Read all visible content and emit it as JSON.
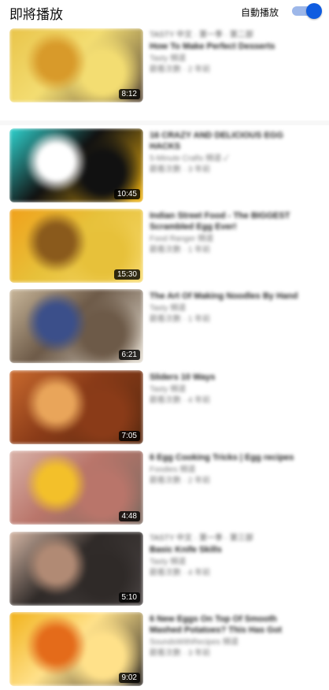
{
  "header": {
    "title": "即將播放",
    "autoplay_label": "自動播放",
    "autoplay_on": true,
    "accent": "#0f5ce0"
  },
  "videos": [
    {
      "tag": "TASTY 中文 · 第一季 · 第二部",
      "title": "How To Make Perfect Desserts",
      "channel": "Tasty 頻道",
      "stats": "觀看次數 · 2 年前",
      "duration": "8:12",
      "colors": [
        "#e9c44a",
        "#f3dd72",
        "#d89a2a",
        "#5a4a3a"
      ]
    },
    {
      "tag": "",
      "title": "16 CRAZY AND DELICIOUS EGG HACKS",
      "channel": "5-Minute Crafts 頻道 ✓",
      "stats": "觀看次數 · 3 年前",
      "duration": "10:45",
      "colors": [
        "#2fd3cf",
        "#111111",
        "#ffffff",
        "#f2b40f"
      ]
    },
    {
      "tag": "",
      "title": "Indian Street Food - The BIGGEST Scrambled Egg Ever!",
      "channel": "Food Ranger 頻道",
      "stats": "觀看次數 · 1 年前",
      "duration": "15:30",
      "colors": [
        "#f0a11b",
        "#e7c13a",
        "#8a5a1c",
        "#f6d86a"
      ]
    },
    {
      "tag": "",
      "title": "The Art Of Making Noodles By Hand",
      "channel": "Tasty 頻道",
      "stats": "觀看次數 · 1 年前",
      "duration": "6:21",
      "colors": [
        "#c9b79a",
        "#6d5a48",
        "#3b4f8a",
        "#e4ddd1"
      ]
    },
    {
      "tag": "",
      "title": "Sliders 10 Ways",
      "channel": "Tasty 頻道",
      "stats": "觀看次數 · 4 年前",
      "duration": "7:05",
      "colors": [
        "#c96a2e",
        "#8a3b18",
        "#e9a55a",
        "#5a2a10"
      ]
    },
    {
      "tag": "",
      "title": "6 Egg Cooking Tricks | Egg recipes",
      "channel": "Foodies 頻道",
      "stats": "觀看次數 · 2 年前",
      "duration": "4:48",
      "colors": [
        "#d9b2a8",
        "#b9756a",
        "#f3c02a",
        "#7d6a60"
      ]
    },
    {
      "tag": "TASTY 中文 · 第一季 · 第三部",
      "title": "Basic Knife Skills",
      "channel": "Tasty 頻道",
      "stats": "觀看次數 · 4 年前",
      "duration": "5:10",
      "colors": [
        "#d5b7a5",
        "#2f2a28",
        "#b18a74",
        "#474140"
      ]
    },
    {
      "tag": "",
      "title": "6 New Eggs On Top Of Smooth Mashed Potatoes? This Has Got",
      "channel": "SoundsWithRecipes 頻道",
      "stats": "觀看次數 · 3 年前",
      "duration": "9:02",
      "colors": [
        "#f1b21c",
        "#ffe18a",
        "#e46b1a",
        "#2f2a25"
      ]
    }
  ]
}
